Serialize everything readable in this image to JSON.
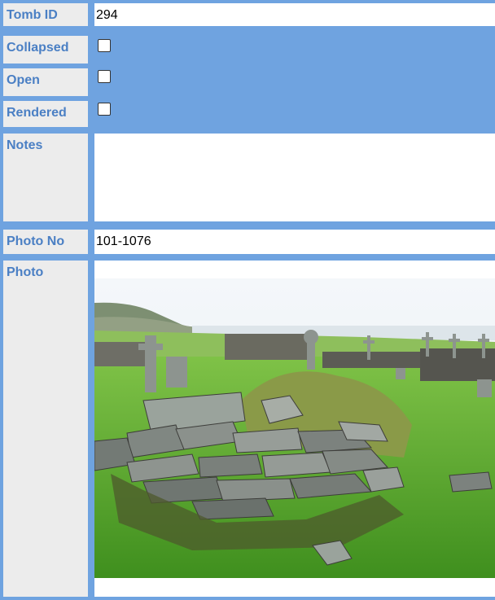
{
  "fields": {
    "tomb_id": {
      "label": "Tomb ID",
      "value": "294"
    },
    "collapsed": {
      "label": "Collapsed",
      "checked": false
    },
    "open": {
      "label": "Open",
      "checked": false
    },
    "rendered": {
      "label": "Rendered",
      "checked": false
    },
    "notes": {
      "label": "Notes",
      "value": ""
    },
    "photo_no": {
      "label": "Photo No",
      "value": "101-1076"
    },
    "photo": {
      "label": "Photo",
      "subject": "collapsed-stone-tomb-in-graveyard"
    }
  },
  "colors": {
    "frame": "#6fa3e0",
    "label_bg": "#ececec",
    "label_text": "#4a7fc4"
  }
}
